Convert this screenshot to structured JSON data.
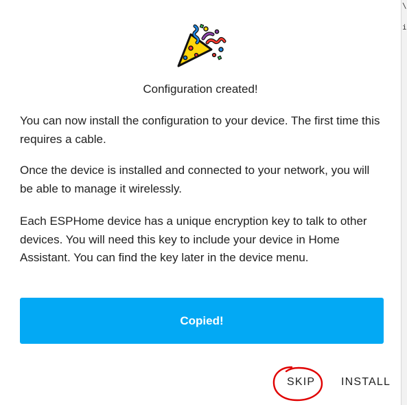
{
  "dialog": {
    "title": "Configuration created!",
    "paragraphs": [
      "You can now install the configuration to your device. The first time this requires a cable.",
      "Once the device is installed and connected to your network, you will be able to manage it wirelessly.",
      "Each ESPHome device has a unique encryption key to talk to other devices. You will need this key to include your device in Home Assistant. You can find the key later in the device menu."
    ],
    "icon": "party-popper-icon",
    "copy_button_label": "Copied!",
    "actions": {
      "skip_label": "SKIP",
      "install_label": "INSTALL"
    }
  },
  "background": {
    "peek_chars": [
      "\\",
      "i"
    ]
  },
  "colors": {
    "button": "#03a9f4",
    "button_text": "#ffffff",
    "text": "#212121",
    "annotation": "#e00000"
  }
}
